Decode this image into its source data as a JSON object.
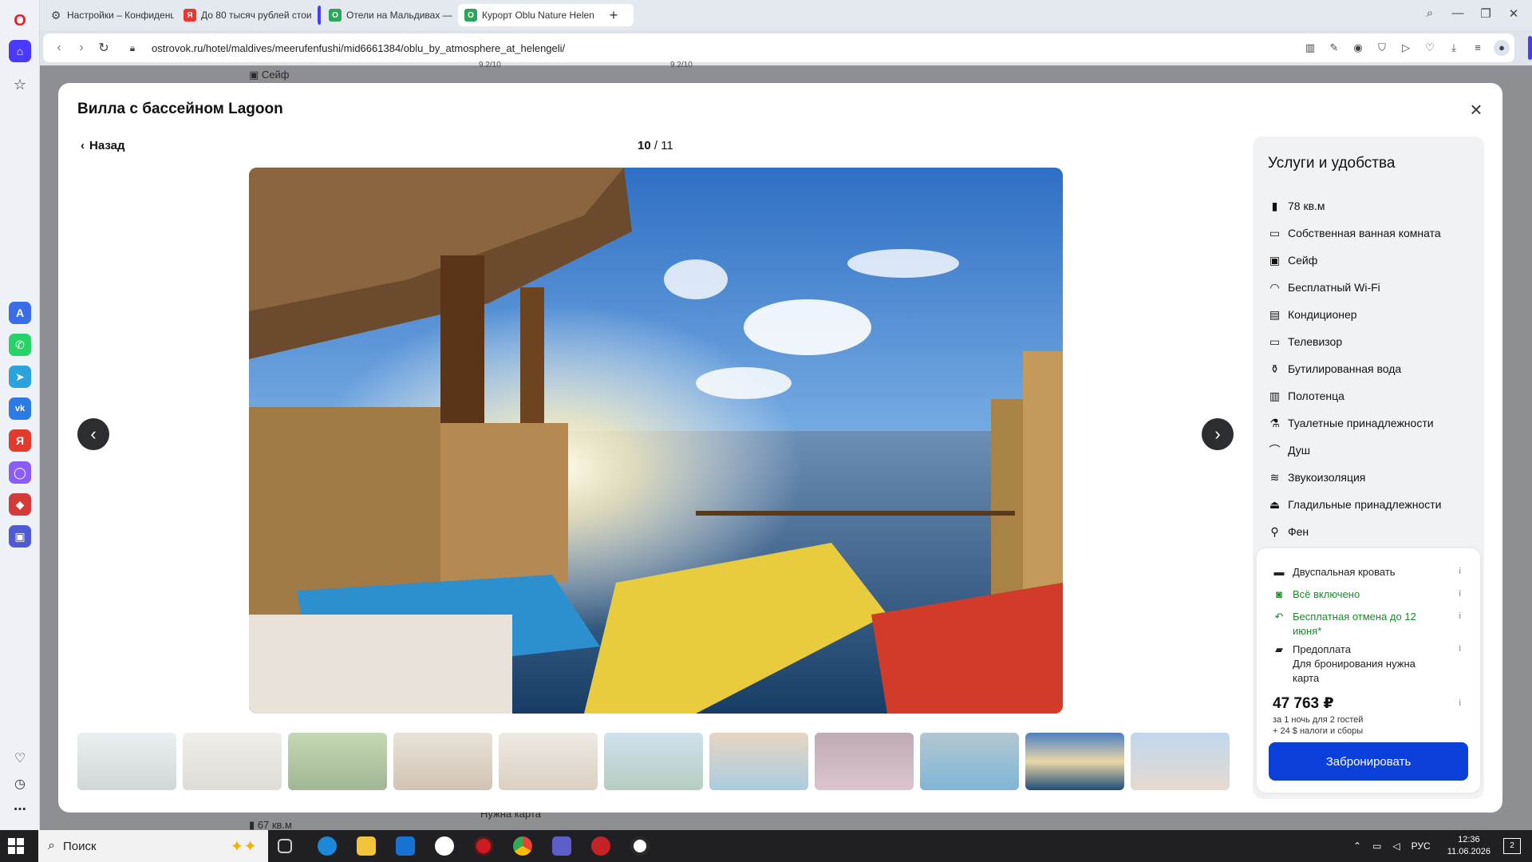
{
  "browser": {
    "tabs": [
      {
        "label": "Настройки – Конфиденц"
      },
      {
        "label": "До 80 тысяч рублей стои"
      },
      {
        "label": "Отели на Мальдивах — з"
      },
      {
        "label": "Курорт Oblu Nature Helen"
      }
    ],
    "url": "ostrovok.ru/hotel/maldives/meerufenfushi/mid6661384/oblu_by_atmosphere_at_helengeli/",
    "bg_texts": {
      "safe": "Сейф",
      "area": "67 кв.м",
      "card": "Нужна карта",
      "top1": "9.2/10",
      "top2": "9.2/10"
    }
  },
  "modal": {
    "title": "Вилла с бассейном Lagoon",
    "back_label": "Назад",
    "counter_current": "10",
    "counter_sep": " / ",
    "counter_total": "11"
  },
  "amenities": {
    "title": "Услуги и удобства",
    "items": [
      {
        "icon": "floor-plan-icon",
        "label": "78 кв.м"
      },
      {
        "icon": "bathtub-icon",
        "label": "Собственная ванная комната"
      },
      {
        "icon": "safe-icon",
        "label": "Сейф"
      },
      {
        "icon": "wifi-icon",
        "label": "Бесплатный Wi-Fi"
      },
      {
        "icon": "air-conditioner-icon",
        "label": "Кондиционер"
      },
      {
        "icon": "tv-icon",
        "label": "Телевизор"
      },
      {
        "icon": "water-bottles-icon",
        "label": "Бутилированная вода"
      },
      {
        "icon": "towel-icon",
        "label": "Полотенца"
      },
      {
        "icon": "toiletries-icon",
        "label": "Туалетные принадлежности"
      },
      {
        "icon": "shower-icon",
        "label": "Душ"
      },
      {
        "icon": "soundproof-icon",
        "label": "Звукоизоляция"
      },
      {
        "icon": "iron-icon",
        "label": "Гладильные принадлежности"
      },
      {
        "icon": "hairdryer-icon",
        "label": "Фен"
      }
    ]
  },
  "booking": {
    "bed": "Двуспальная кровать",
    "meal": "Всё включено",
    "cancel": "Бесплатная отмена до 12 июня*",
    "prepay_title": "Предоплата",
    "prepay_note": "Для бронирования нужна карта",
    "price": "47 763 ₽",
    "price_note_1": "за 1 ночь для 2 гостей",
    "price_note_2": "+ 24 $ налоги и сборы",
    "book_label": "Забронировать",
    "info_glyph": "i",
    "green_color": "#1c8a2b",
    "button_color": "#0a40d9"
  },
  "gallery": {
    "thumb_count": 11,
    "active_index": 10
  },
  "taskbar": {
    "search_label": "Поиск",
    "lang": "РУС",
    "time": "12:36",
    "date": "11.06.2026",
    "notif_count": "2"
  }
}
